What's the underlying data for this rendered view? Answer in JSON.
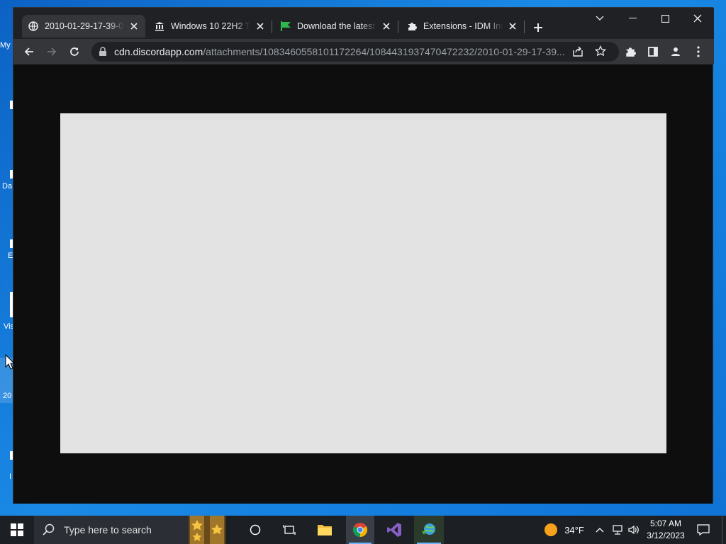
{
  "desktop": {
    "icons": [
      {
        "label": "My"
      },
      {
        "label": "Da"
      },
      {
        "label": "E"
      },
      {
        "label": "Vis"
      },
      {
        "label": "20"
      },
      {
        "label": "I"
      }
    ]
  },
  "browser": {
    "tabs": [
      {
        "title": "2010-01-29-17-39-04",
        "icon": "globe-icon",
        "active": true
      },
      {
        "title": "Windows 10 22H2 Tu",
        "icon": "bank-icon",
        "active": false
      },
      {
        "title": "Download the latest I",
        "icon": "green-flag-icon",
        "active": false
      },
      {
        "title": "Extensions - IDM Inte",
        "icon": "puzzle-icon",
        "active": false
      }
    ],
    "url_host": "cdn.discordapp.com",
    "url_path": "/attachments/1083460558101172264/1084431937470472232/2010-01-29-17-39..."
  },
  "taskbar": {
    "search_placeholder": "Type here to search",
    "weather_temp": "34°F",
    "clock_time": "5:07 AM",
    "clock_date": "3/12/2023"
  },
  "colors": {
    "desktop_blue": "#0f73d6",
    "tabstrip": "#202124",
    "toolbar": "#35363a",
    "image_placeholder": "#e3e3e3"
  }
}
